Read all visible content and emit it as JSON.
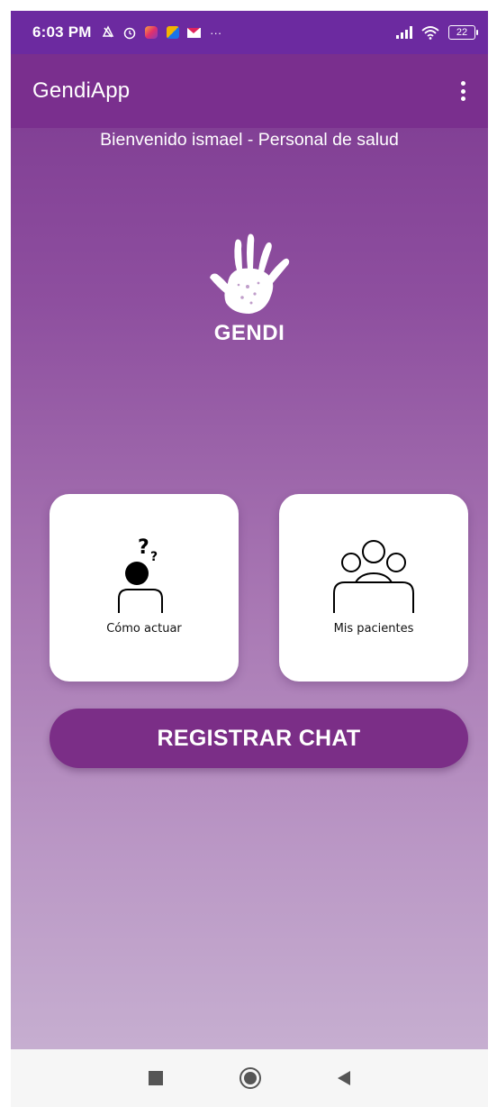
{
  "status_bar": {
    "time": "6:03 PM",
    "notification_icons": [
      "alarm-off-icon",
      "alarm-clock-icon",
      "instagram-icon",
      "google-photos-icon",
      "gmail-icon",
      "more-dots-icon"
    ],
    "more": "···",
    "battery": "22"
  },
  "app_bar": {
    "title": "GendiApp",
    "menu_icon": "overflow-menu-icon"
  },
  "welcome_text": "Bienvenido ismael - Personal de salud",
  "logo": {
    "icon": "hand-print-icon",
    "text": "GENDI"
  },
  "cards": [
    {
      "label": "Cómo actuar",
      "icon": "person-question-icon"
    },
    {
      "label": "Mis pacientes",
      "icon": "group-people-icon"
    }
  ],
  "chat_button": {
    "label": "REGISTRAR CHAT"
  },
  "nav_bar": {
    "icons": [
      "recents-square-icon",
      "home-circle-icon",
      "back-triangle-icon"
    ]
  },
  "colors": {
    "status_bar": "#6c2aa0",
    "app_bar": "#7a2f8e",
    "gradient_top": "#7d3a91",
    "gradient_bottom": "#c6aed0",
    "button": "#7b2e87",
    "card": "#ffffff"
  }
}
